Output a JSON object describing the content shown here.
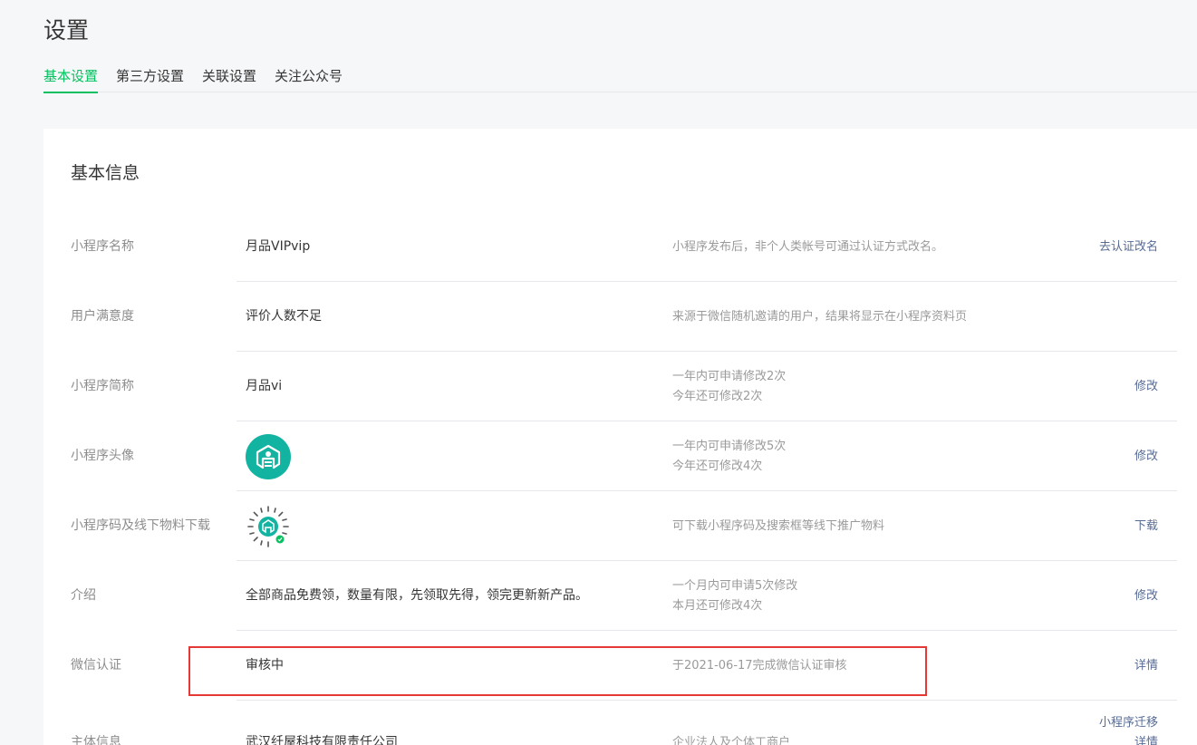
{
  "page": {
    "title": "设置"
  },
  "tabs": [
    {
      "label": "基本设置",
      "active": true
    },
    {
      "label": "第三方设置",
      "active": false
    },
    {
      "label": "关联设置",
      "active": false
    },
    {
      "label": "关注公众号",
      "active": false
    }
  ],
  "section": {
    "title": "基本信息"
  },
  "rows": {
    "name": {
      "label": "小程序名称",
      "value": "月品VIPvip",
      "desc": "小程序发布后，非个人类帐号可通过认证方式改名。",
      "action": "去认证改名"
    },
    "satisfaction": {
      "label": "用户满意度",
      "value": "评价人数不足",
      "desc": "来源于微信随机邀请的用户，结果将显示在小程序资料页"
    },
    "short_name": {
      "label": "小程序简称",
      "value": "月品vi",
      "desc_line1": "一年内可申请修改2次",
      "desc_line2": "今年还可修改2次",
      "action": "修改"
    },
    "avatar": {
      "label": "小程序头像",
      "desc_line1": "一年内可申请修改5次",
      "desc_line2": "今年还可修改4次",
      "action": "修改",
      "color": "#12b3a0"
    },
    "qrcode": {
      "label": "小程序码及线下物料下载",
      "desc": "可下载小程序码及搜索框等线下推广物料",
      "action": "下载"
    },
    "intro": {
      "label": "介绍",
      "value": "全部商品免费领，数量有限，先领取先得，领完更新新产品。",
      "desc_line1": "一个月内可申请5次修改",
      "desc_line2": "本月还可修改4次",
      "action": "修改"
    },
    "wechat_auth": {
      "label": "微信认证",
      "value": "审核中",
      "desc": "于2021-06-17完成微信认证审核",
      "action": "详情"
    },
    "entity": {
      "label": "主体信息",
      "value": "武汉纤屋科技有限责任公司",
      "desc": "企业法人及个体工商户",
      "action_line1": "小程序迁移",
      "action_line2": "详情"
    }
  },
  "colors": {
    "accent": "#07c160",
    "link": "#576b95",
    "highlight": "#e53935"
  }
}
